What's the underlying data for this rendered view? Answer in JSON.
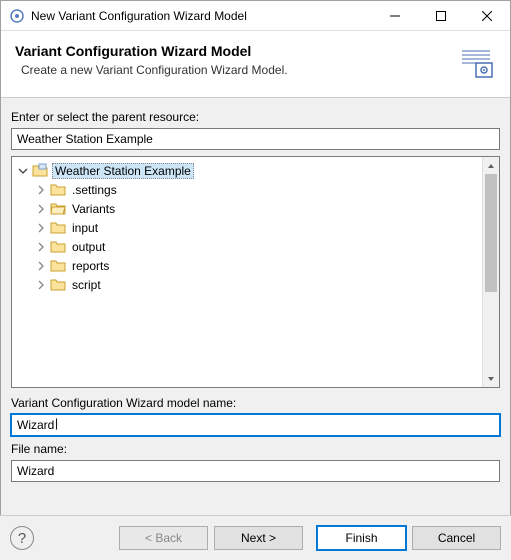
{
  "titlebar": {
    "title": "New Variant Configuration Wizard Model"
  },
  "banner": {
    "title": "Variant Configuration Wizard Model",
    "subtitle": "Create a new Variant Configuration Wizard Model."
  },
  "labels": {
    "parent_resource": "Enter or select the parent resource:",
    "model_name": "Variant Configuration Wizard model name:",
    "file_name": "File name:"
  },
  "fields": {
    "parent_resource": "Weather Station Example",
    "model_name": "Wizard",
    "file_name": "Wizard"
  },
  "tree": {
    "root": {
      "label": "Weather Station Example"
    },
    "children": [
      {
        "label": ".settings"
      },
      {
        "label": "Variants"
      },
      {
        "label": "input"
      },
      {
        "label": "output"
      },
      {
        "label": "reports"
      },
      {
        "label": "script"
      }
    ]
  },
  "buttons": {
    "back": "< Back",
    "next": "Next >",
    "finish": "Finish",
    "cancel": "Cancel"
  }
}
